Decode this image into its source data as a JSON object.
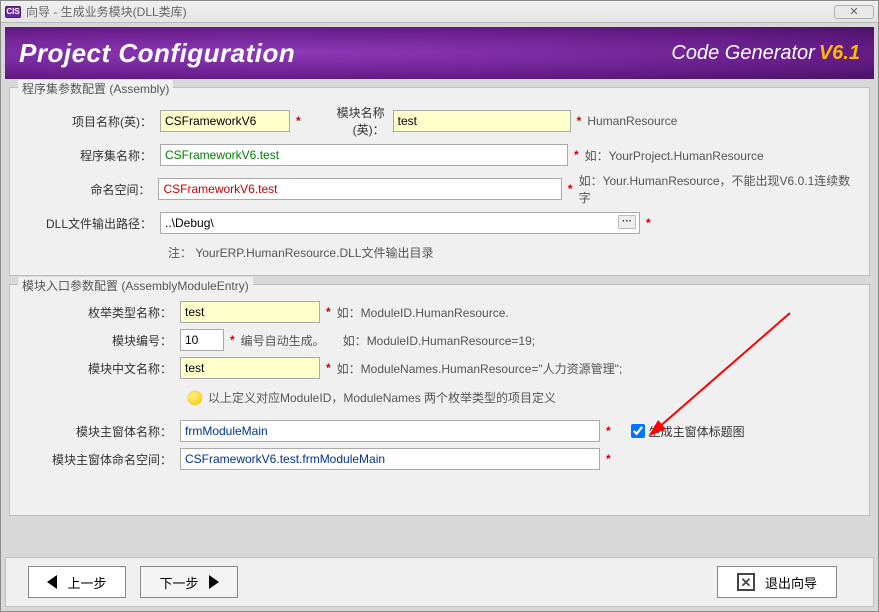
{
  "window": {
    "title": "向导 - 生成业务模块(DLL类库)"
  },
  "banner": {
    "main_title": "Project Configuration",
    "product": "Code Generator",
    "version": "V6.1"
  },
  "group1": {
    "legend": "程序集参数配置 (Assembly)",
    "project_name_lbl": "项目名称(英)：",
    "project_name_val": "CSFrameworkV6",
    "module_name_lbl": "模块名称(英)：",
    "module_name_val": "test",
    "module_name_hint": "HumanResource",
    "assembly_name_lbl": "程序集名称：",
    "assembly_name_val": "CSFrameworkV6.test",
    "assembly_name_hint": "如：YourProject.HumanResource",
    "namespace_lbl": "命名空间：",
    "namespace_val": "CSFrameworkV6.test",
    "namespace_hint": "如：Your.HumanResource，不能出现V6.0.1连续数字",
    "dll_path_lbl": "DLL文件输出路径：",
    "dll_path_val": "..\\Debug\\",
    "dll_note_prefix": "注：",
    "dll_note": "YourERP.HumanResource.DLL文件输出目录"
  },
  "group2": {
    "legend": "模块入口参数配置 (AssemblyModuleEntry)",
    "enum_lbl": "枚举类型名称：",
    "enum_val": "test",
    "enum_hint": "如：ModuleID.HumanResource.",
    "modid_lbl": "模块编号：",
    "modid_val": "10",
    "modid_auto": "编号自动生成。",
    "modid_hint": "如：ModuleID.HumanResource=19;",
    "modcn_lbl": "模块中文名称：",
    "modcn_val": "test",
    "modcn_hint": "如：ModuleNames.HumanResource=\"人力资源管理\";",
    "bulb_text": "以上定义对应ModuleID，ModuleNames   两个枚举类型的项目定义",
    "mainform_lbl": "模块主窗体名称：",
    "mainform_val": "frmModuleMain",
    "gen_caption_chk": "生成主窗体标题图",
    "mainns_lbl": "模块主窗体命名空间：",
    "mainns_val": "CSFrameworkV6.test.frmModuleMain"
  },
  "footer": {
    "prev": "上一步",
    "next": "下一步",
    "exit": "退出向导"
  }
}
